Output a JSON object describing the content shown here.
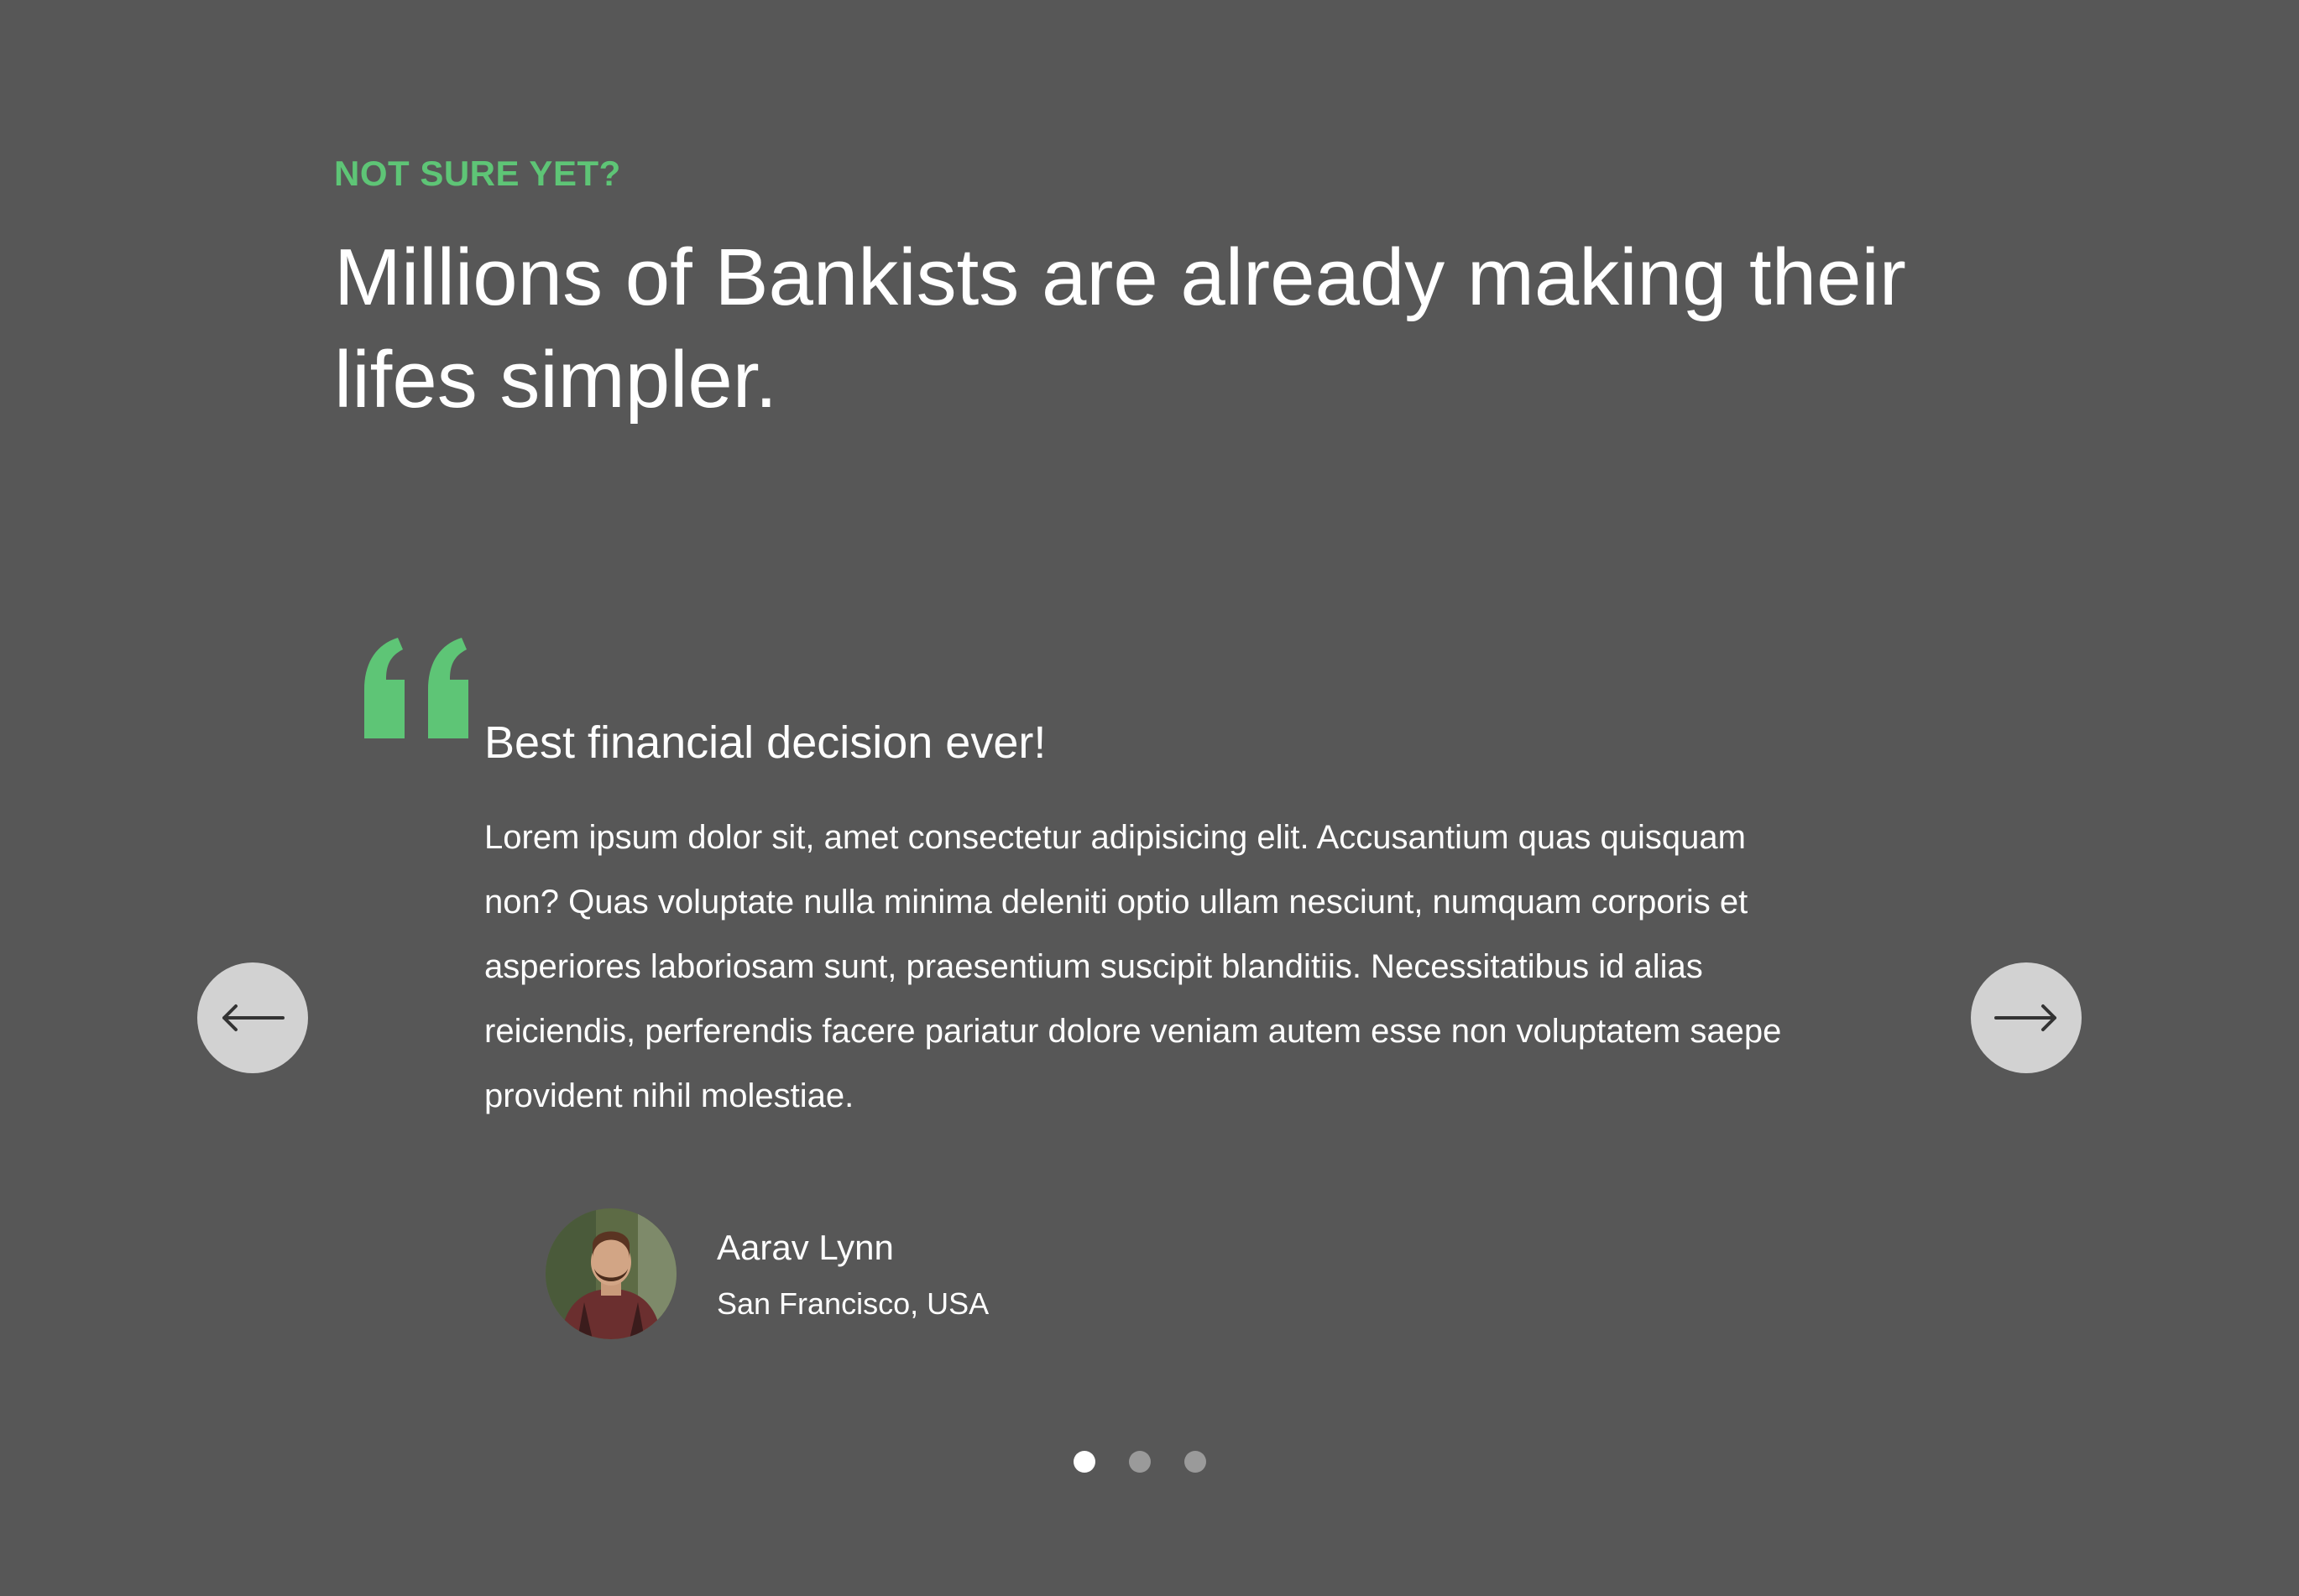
{
  "section": {
    "eyebrow": "NOT SURE YET?",
    "headline": "Millions of Bankists are already making their lifes simpler."
  },
  "colors": {
    "background": "#575757",
    "accent": "#5ec576",
    "button_bg": "#d2d2d2",
    "dot_active": "#ffffff",
    "dot_inactive": "#9a9a9a"
  },
  "slider": {
    "prev_icon": "arrow-left-icon",
    "next_icon": "arrow-right-icon",
    "prev_label": "←",
    "next_label": "→",
    "active_slide": 1,
    "slide_count": 3
  },
  "testimonial": {
    "quote_icon": "quote-mark-icon",
    "title": "Best financial decision ever!",
    "text": "Lorem ipsum dolor sit, amet consectetur adipisicing elit. Accusantium quas quisquam non? Quas voluptate nulla minima deleniti optio ullam nesciunt, numquam corporis et asperiores laboriosam sunt, praesentium suscipit blanditiis. Necessitatibus id alias reiciendis, perferendis facere pariatur dolore veniam autem esse non voluptatem saepe provident nihil molestiae.",
    "author": {
      "name": "Aarav Lynn",
      "location": "San Francisco, USA",
      "avatar_icon": "user-avatar"
    }
  }
}
